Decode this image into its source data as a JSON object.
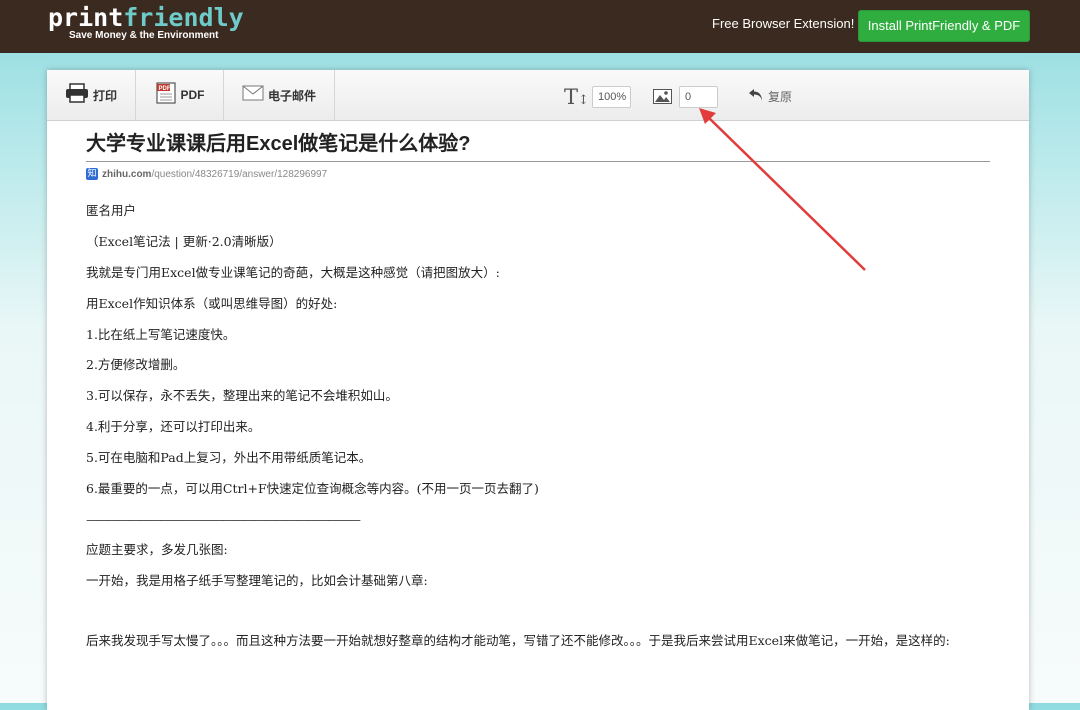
{
  "brand": {
    "logo_print": "print",
    "logo_friendly": "friendly",
    "tagline": "Save Money & the Environment",
    "extension_text": "Free  Browser Extension!",
    "install_button": "Install PrintFriendly & PDF",
    "colors": {
      "bar": "#3b2a20",
      "accent": "#6ecbc9",
      "install": "#2fae3f"
    }
  },
  "toolbar": {
    "print_label": "打印",
    "pdf_label": "PDF",
    "email_label": "电子邮件",
    "text_size_value": "100%",
    "image_size_value": "0",
    "undo_label": "复原",
    "icons": [
      "printer-icon",
      "pdf-icon",
      "envelope-icon",
      "text-size-icon",
      "image-icon",
      "undo-icon"
    ]
  },
  "article": {
    "title": "大学专业课课后用Excel做笔记是什么体验?",
    "source_domain": "zhihu.com",
    "source_path": "/question/48326719/answer/128296997",
    "paragraphs": [
      "匿名用户",
      "（Excel笔记法 | 更新·2.0清晰版）",
      "我就是专门用Excel做专业课笔记的奇葩，大概是这种感觉（请把图放大）:",
      "用Excel作知识体系（或叫思维导图）的好处:",
      "1.比在纸上写笔记速度快。",
      "2.方便修改增删。",
      "3.可以保存，永不丢失，整理出来的笔记不会堆积如山。",
      "4.利于分享，还可以打印出来。",
      "5.可在电脑和Pad上复习，外出不用带纸质笔记本。",
      "6.最重要的一点，可以用Ctrl+F快速定位查询概念等内容。(不用一页一页去翻了)",
      "——————————————————————————",
      "应题主要求，多发几张图:",
      "一开始，我是用格子纸手写整理笔记的，比如会计基础第八章:",
      "后来我发现手写太慢了。。。而且这种方法要一开始就想好整章的结构才能动笔，写错了还不能修改。。。于是我后来尝试用Excel来做笔记，一开始，是这样的:"
    ]
  }
}
